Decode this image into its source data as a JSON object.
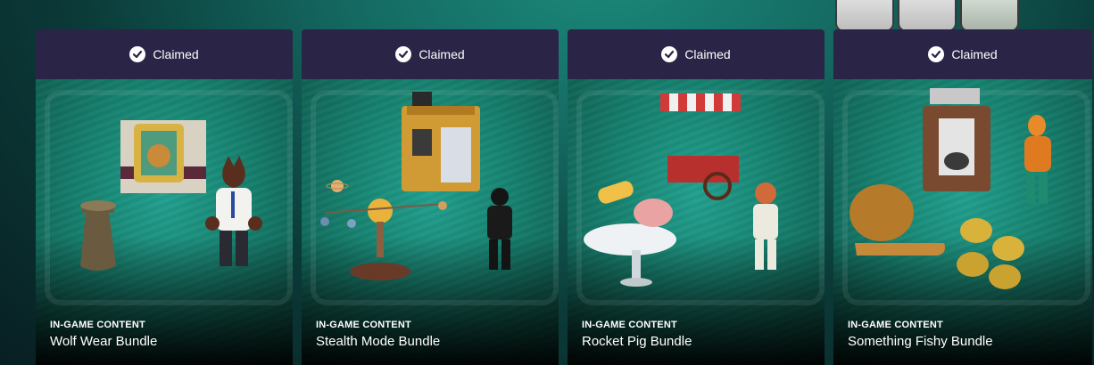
{
  "cards": [
    {
      "status": "Claimed",
      "status_icon": "checkmark-icon",
      "category": "IN-GAME CONTENT",
      "title": "Wolf Wear Bundle"
    },
    {
      "status": "Claimed",
      "status_icon": "checkmark-icon",
      "category": "IN-GAME CONTENT",
      "title": "Stealth Mode Bundle"
    },
    {
      "status": "Claimed",
      "status_icon": "checkmark-icon",
      "category": "IN-GAME CONTENT",
      "title": "Rocket Pig Bundle"
    },
    {
      "status": "Claimed",
      "status_icon": "checkmark-icon",
      "category": "IN-GAME CONTENT",
      "title": "Something Fishy Bundle"
    }
  ],
  "colors": {
    "card_header": "#2a2447",
    "card_background": "#17816f",
    "page_background": "#0b3a38"
  }
}
